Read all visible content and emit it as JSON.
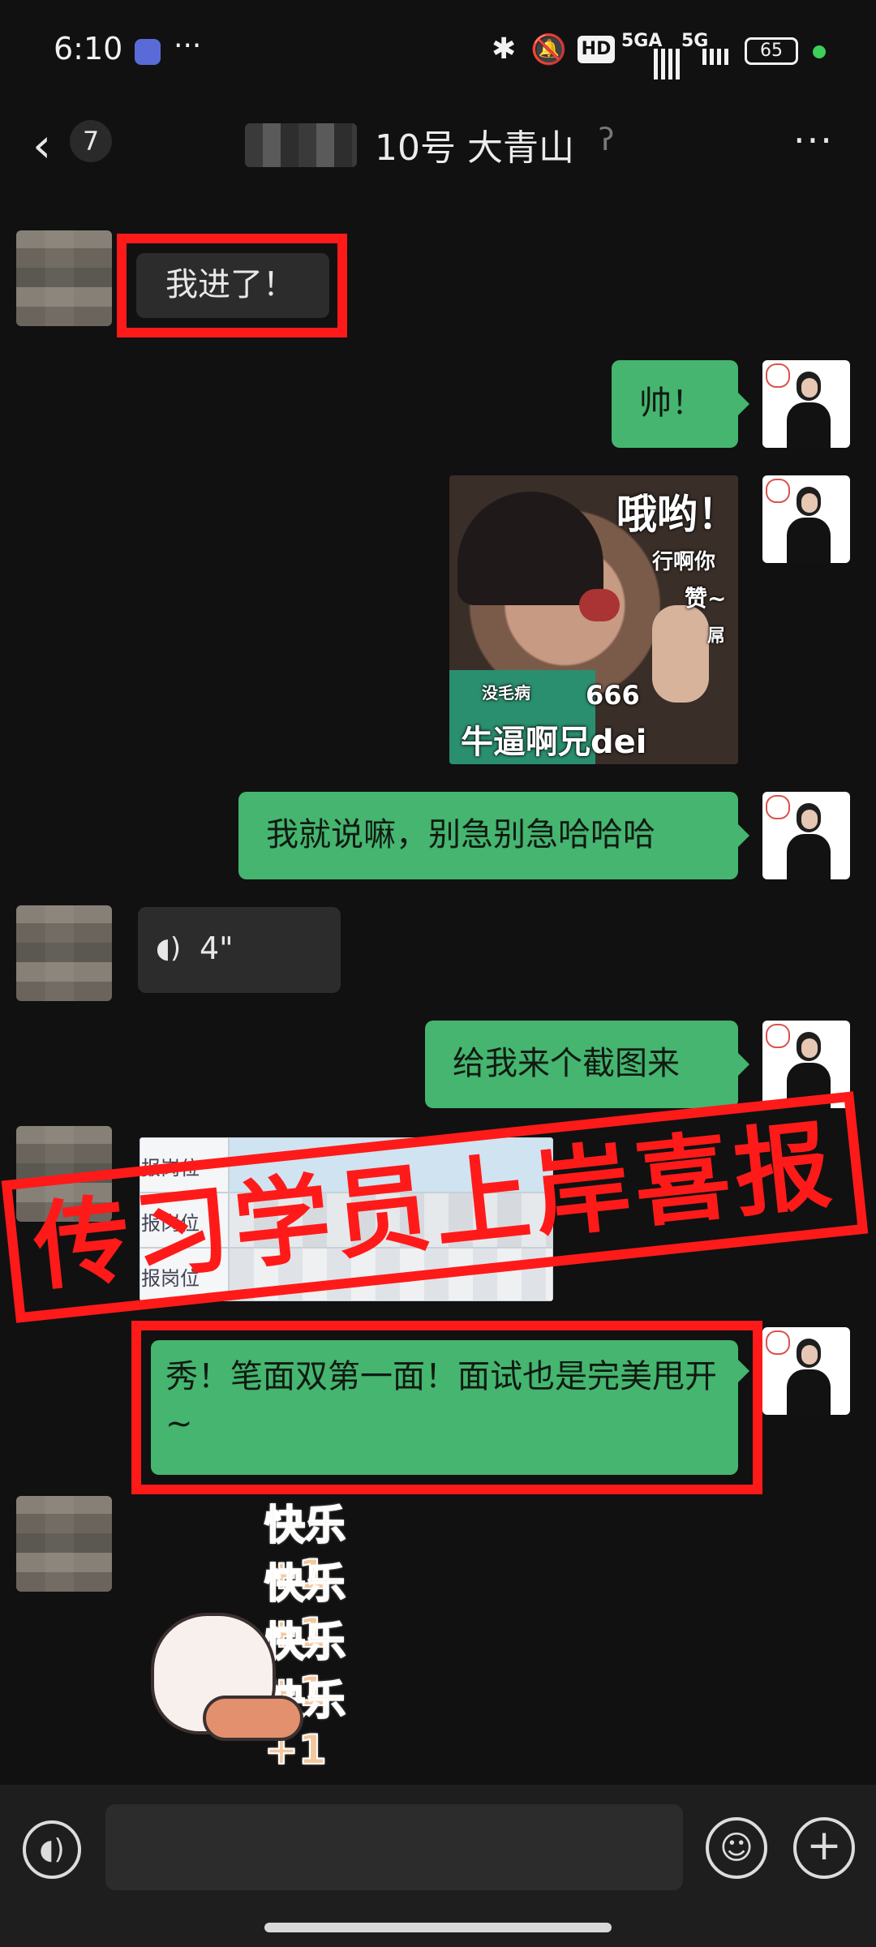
{
  "status_bar": {
    "time": "6:10",
    "more_dots": "···",
    "network_1": "5GA",
    "network_2": "5G",
    "hd_label": "HD",
    "battery": "65",
    "icons": [
      "app-notification-icon",
      "bluetooth-icon",
      "mute-icon",
      "signal-icon",
      "battery-icon",
      "privacy-dot-icon"
    ]
  },
  "header": {
    "back_icon": "‹",
    "unread_count": "7",
    "title": "10号 大青山",
    "more_icon": "···"
  },
  "messages": [
    {
      "side": "left",
      "type": "text",
      "text": "我进了！",
      "highlighted": true
    },
    {
      "side": "right",
      "type": "text",
      "text": "帅！"
    },
    {
      "side": "right",
      "type": "image",
      "name": "meme-sticker",
      "captions": [
        "哦哟！",
        "行啊你",
        "赞~",
        "屌",
        "没毛病",
        "666",
        "牛逼啊兄dei"
      ]
    },
    {
      "side": "right",
      "type": "text",
      "text": "我就说嘛，别急别急哈哈哈"
    },
    {
      "side": "left",
      "type": "voice",
      "duration": "4\""
    },
    {
      "side": "right",
      "type": "text",
      "text": "给我来个截图来"
    },
    {
      "side": "left",
      "type": "image",
      "name": "result-screenshot",
      "row_labels": [
        "报岗位",
        "报岗位",
        "报岗位"
      ]
    },
    {
      "side": "right",
      "type": "text",
      "text": "秀！笔面双第一面！面试也是完美甩开~",
      "highlighted": true
    },
    {
      "side": "left",
      "type": "sticker",
      "name": "happy-plus-one-sticker",
      "text": "快乐+1"
    }
  ],
  "banner": {
    "text": "传习学员上岸喜报",
    "color": "#ff1a1a"
  },
  "input_bar": {
    "placeholder": "",
    "icons": [
      "voice-icon",
      "emoji-icon",
      "plus-icon"
    ]
  },
  "colors": {
    "background": "#111111",
    "bubble_green": "#45b56f",
    "bubble_grey": "#2c2c2c",
    "highlight_red": "#ff1a1a"
  }
}
